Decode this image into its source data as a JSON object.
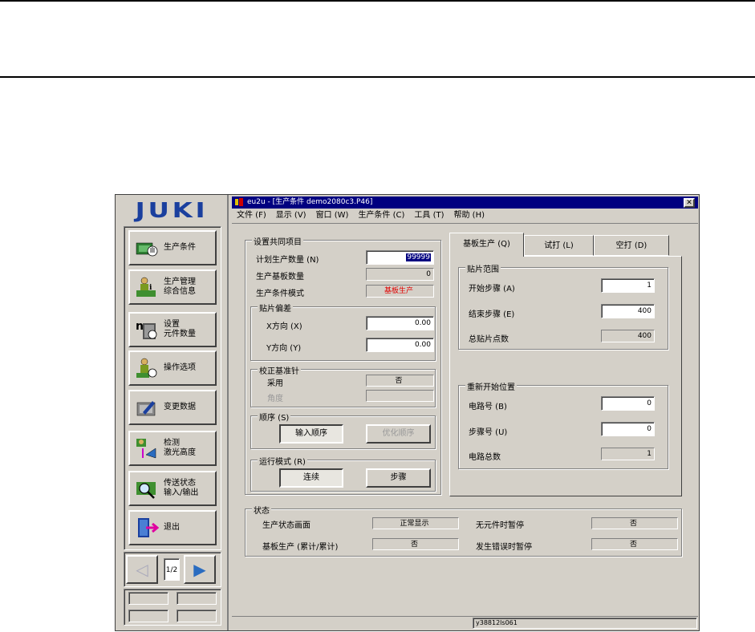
{
  "window": {
    "title": "eu2u - [生产条件 demo2080c3.P46]",
    "close_glyph": "✕"
  },
  "menu": [
    "文件 (F)",
    "显示 (V)",
    "窗口 (W)",
    "生产条件 (C)",
    "工具 (T)",
    "帮助 (H)"
  ],
  "brand": "JUKI",
  "sidebar": {
    "buttons": [
      {
        "line1": "生产条件",
        "line2": ""
      },
      {
        "line1": "生产管理",
        "line2": "综合信息"
      },
      {
        "line1": "设置",
        "line2": "元件数量"
      },
      {
        "line1": "操作选项",
        "line2": ""
      },
      {
        "line1": "变更数据",
        "line2": ""
      },
      {
        "line1": "检测",
        "line2": "激光高度"
      },
      {
        "line1": "传送状态",
        "line2": "输入/输出"
      },
      {
        "line1": "退出",
        "line2": ""
      }
    ],
    "pager": {
      "prev": "◁",
      "next": "▶",
      "page": "1/2"
    }
  },
  "common": {
    "title": "设置共同项目",
    "plan_qty_label": "计划生产数量 (N)",
    "plan_qty_value": "99999",
    "board_qty_label": "生产基板数量",
    "board_qty_value": "0",
    "mode_label": "生产条件模式",
    "mode_value": "基板生产",
    "offset": {
      "title": "贴片偏差",
      "x_label": "X方向 (X)",
      "x_value": "0.00",
      "y_label": "Y方向 (Y)",
      "y_value": "0.00"
    },
    "pin": {
      "title": "校正基准针",
      "use_label": "采用",
      "use_value": "否",
      "angle_label": "角度",
      "angle_value": ""
    },
    "order": {
      "title": "顺序 (S)",
      "btn1": "输入顺序",
      "btn2": "优化顺序"
    },
    "run": {
      "title": "运行模式 (R)",
      "btn1": "连续",
      "btn2": "步骤"
    }
  },
  "tabs": [
    "基板生产 (Q)",
    "试打 (L)",
    "空打 (D)"
  ],
  "range": {
    "title": "贴片范围",
    "start_label": "开始步骤 (A)",
    "start_value": "1",
    "end_label": "结束步骤 (E)",
    "end_value": "400",
    "total_label": "总贴片点数",
    "total_value": "400"
  },
  "restart": {
    "title": "重新开始位置",
    "circuit_label": "电路号 (B)",
    "circuit_value": "0",
    "step_label": "步骤号 (U)",
    "step_value": "0",
    "total_label": "电路总数",
    "total_value": "1"
  },
  "status": {
    "title": "状态",
    "screen_label": "生产状态画面",
    "screen_value": "正常显示",
    "nopart_label": "无元件时暂停",
    "nopart_value": "否",
    "board_label": "基板生产 (累计/累计)",
    "board_value": "否",
    "error_label": "发生错误时暂停",
    "error_value": "否"
  },
  "statusbar": {
    "code": "y38812ls061"
  },
  "colors": {
    "face": "#d4d0c8",
    "title_bar": "#000080",
    "brand": "#1a3f9e",
    "mode_red": "#e00000"
  }
}
